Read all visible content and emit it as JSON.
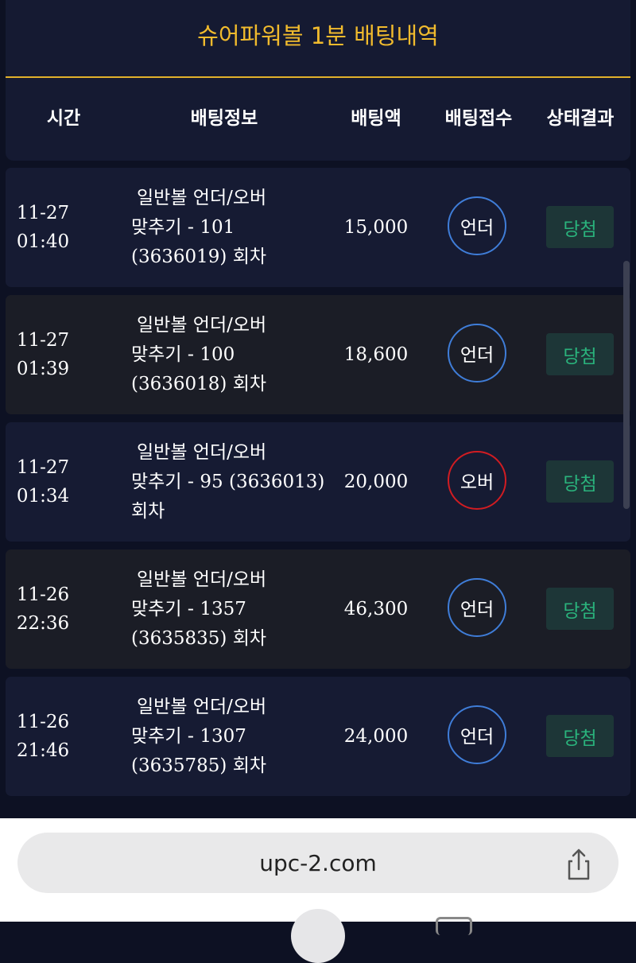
{
  "page": {
    "title": "슈어파워볼 1분 배팅내역"
  },
  "columns": {
    "time": "시간",
    "info": "배팅정보",
    "amount": "배팅액",
    "pick": "배팅접수",
    "result": "상태결과"
  },
  "colors": {
    "gold": "#f1bb2d",
    "under_border": "#3f7dd8",
    "over_border": "#d11c22",
    "win_text": "#2ab37c"
  },
  "rows": [
    {
      "date": "11-27",
      "time": "01:40",
      "info_line1": "일반볼 언더/오버",
      "info_line2_prefix": "맞추기 - ",
      "info_line2_num": "101",
      "info_line3_num": "(3636019)",
      "info_line3_suffix": " 회차",
      "amount": "15,000",
      "pick": "언더",
      "result": "당첨"
    },
    {
      "date": "11-27",
      "time": "01:39",
      "info_line1": "일반볼 언더/오버",
      "info_line2_prefix": "맞추기 - ",
      "info_line2_num": "100",
      "info_line3_num": "(3636018)",
      "info_line3_suffix": " 회차",
      "amount": "18,600",
      "pick": "언더",
      "result": "당첨"
    },
    {
      "date": "11-27",
      "time": "01:34",
      "info_line1": "일반볼 언더/오버",
      "info_line2_prefix": "맞추기 - ",
      "info_line2_num": "95 (3636013)",
      "info_line3_num": "",
      "info_line3_suffix": "회차",
      "amount": "20,000",
      "pick": "오버",
      "result": "당첨"
    },
    {
      "date": "11-26",
      "time": "22:36",
      "info_line1": "일반볼 언더/오버",
      "info_line2_prefix": "맞추기 - ",
      "info_line2_num": "1357",
      "info_line3_num": "(3635835)",
      "info_line3_suffix": " 회차",
      "amount": "46,300",
      "pick": "언더",
      "result": "당첨"
    },
    {
      "date": "11-26",
      "time": "21:46",
      "info_line1": "일반볼 언더/오버",
      "info_line2_prefix": "맞추기 - ",
      "info_line2_num": "1307",
      "info_line3_num": "(3635785)",
      "info_line3_suffix": " 회차",
      "amount": "24,000",
      "pick": "언더",
      "result": "당첨"
    }
  ],
  "browser": {
    "url": "upc-2.com",
    "share_icon": "share-icon"
  }
}
